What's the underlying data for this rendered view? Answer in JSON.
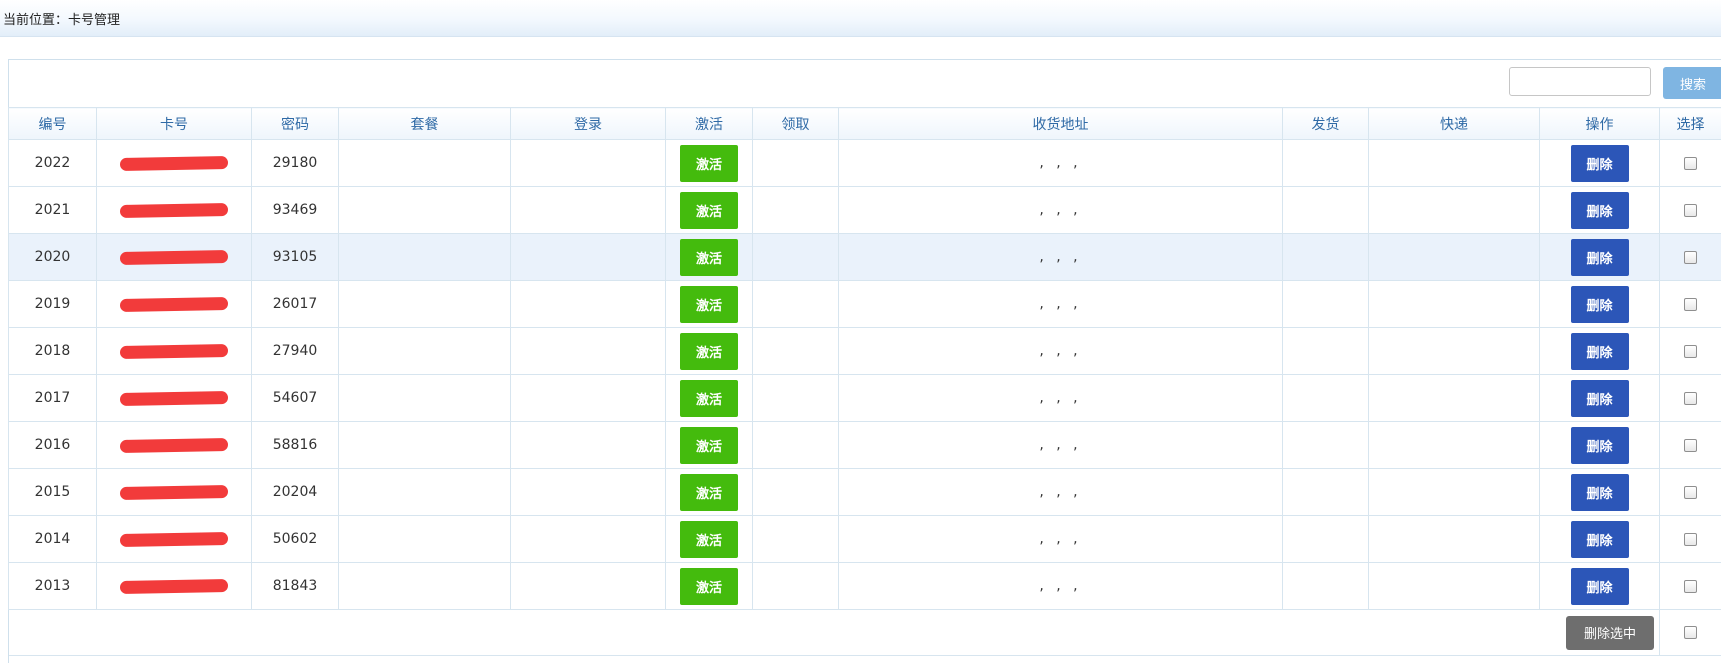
{
  "breadcrumb": "当前位置：卡号管理",
  "search": {
    "placeholder": "",
    "value": "",
    "button_label": "搜索"
  },
  "columns": [
    "编号",
    "卡号",
    "密码",
    "套餐",
    "登录",
    "激活",
    "领取",
    "收货地址",
    "发货",
    "快递",
    "操作",
    "选择"
  ],
  "rows": [
    {
      "id": "2022",
      "password": "29180",
      "address": ", , ,"
    },
    {
      "id": "2021",
      "password": "93469",
      "address": ", , ,"
    },
    {
      "id": "2020",
      "password": "93105",
      "address": ", , ,"
    },
    {
      "id": "2019",
      "password": "26017",
      "address": ", , ,"
    },
    {
      "id": "2018",
      "password": "27940",
      "address": ", , ,"
    },
    {
      "id": "2017",
      "password": "54607",
      "address": ", , ,"
    },
    {
      "id": "2016",
      "password": "58816",
      "address": ", , ,"
    },
    {
      "id": "2015",
      "password": "20204",
      "address": ", , ,"
    },
    {
      "id": "2014",
      "password": "50602",
      "address": ", , ,"
    },
    {
      "id": "2013",
      "password": "81843",
      "address": ", , ,"
    }
  ],
  "highlighted_row_id": "2020",
  "activate_label": "激活",
  "delete_label": "删除",
  "delete_selected_label": "删除选中",
  "colors": {
    "activate": "#44bb0d",
    "delete": "#2c56b8",
    "delete_selected": "#6e6e6e",
    "search_button": "#7fb5e2",
    "header_text": "#2f6aa6",
    "redaction": "#f23b3b",
    "row_highlight": "#eaf2fb"
  }
}
